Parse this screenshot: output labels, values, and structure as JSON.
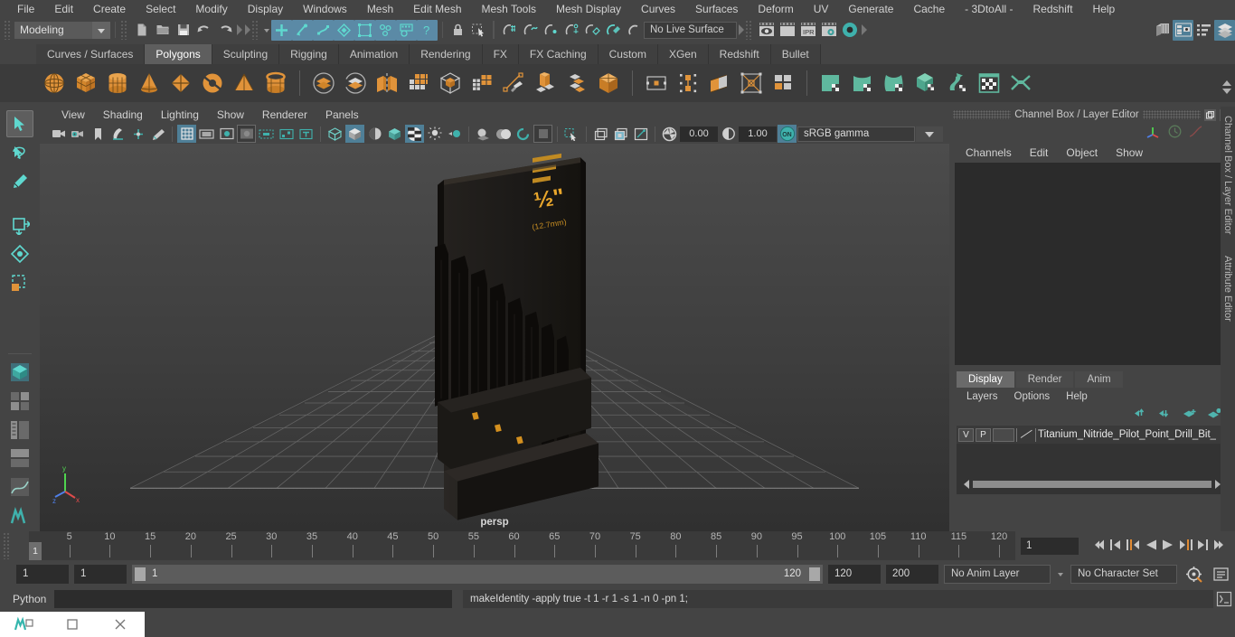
{
  "app": {
    "name": "Autodesk Maya"
  },
  "menubar": {
    "items": [
      "File",
      "Edit",
      "Create",
      "Select",
      "Modify",
      "Display",
      "Windows",
      "Mesh",
      "Edit Mesh",
      "Mesh Tools",
      "Mesh Display",
      "Curves",
      "Surfaces",
      "Deform",
      "UV",
      "Generate",
      "Cache",
      "- 3DtoAll -",
      "Redshift",
      "Help"
    ]
  },
  "statusline": {
    "menu_set": "Modeling",
    "live_surface": "No Live Surface",
    "icons": [
      "new-scene-icon",
      "open-scene-icon",
      "save-scene-icon",
      "undo-icon",
      "redo-icon",
      "select-by-hierarchy-icon",
      "select-by-object-icon",
      "select-by-component-icon",
      "snap-to-grid-icon",
      "snap-to-curve-icon",
      "snap-to-point-icon",
      "snap-to-projected-center-icon",
      "snap-to-view-plane-icon",
      "make-live-icon",
      "render-current-frame-icon",
      "ipr-render-icon",
      "render-settings-icon",
      "render-view-icon",
      "show-hide-editors-icon",
      "sidebar-channel-box-icon",
      "sidebar-attribute-editor-icon",
      "sidebar-tool-settings-icon"
    ]
  },
  "shelf": {
    "tabs": [
      "Curves / Surfaces",
      "Polygons",
      "Sculpting",
      "Rigging",
      "Animation",
      "Rendering",
      "FX",
      "FX Caching",
      "Custom",
      "XGen",
      "Redshift",
      "Bullet"
    ],
    "active_tab": "Polygons",
    "icons": [
      "poly-sphere-icon",
      "poly-cube-icon",
      "poly-cylinder-icon",
      "poly-cone-icon",
      "poly-plane-icon",
      "poly-torus-icon",
      "poly-pyramid-icon",
      "poly-pipe-icon",
      "poly-booleans-union-icon",
      "poly-booleans-difference-icon",
      "poly-mirror-icon",
      "poly-smooth-icon",
      "poly-combine-icon",
      "poly-reduce-icon",
      "poly-multi-cut-icon",
      "poly-extrude-icon",
      "poly-bevel-icon",
      "poly-bridge-icon",
      "poly-target-weld-icon",
      "poly-connect-icon",
      "poly-append-icon",
      "poly-crease-icon",
      "poly-quad-draw-icon",
      "uv-planar-icon",
      "uv-cylindrical-icon",
      "uv-spherical-icon",
      "uv-automatic-icon",
      "uv-unfold-icon",
      "uv-editor-icon",
      "uv-cut-sew-icon"
    ]
  },
  "toolbox": {
    "tools": [
      "select-tool",
      "lasso-select-tool",
      "paint-select-tool",
      "move-tool",
      "rotate-tool",
      "scale-tool",
      "last-tool-used",
      "show-manipulator-tool"
    ],
    "layout_icons": [
      "single-perspective-layout-icon",
      "four-view-layout-icon",
      "outliner-persp-layout-icon",
      "hypershade-layout-icon",
      "persp-graph-layout-icon",
      "maya-embedded-layout-icon"
    ]
  },
  "viewport": {
    "menus": [
      "View",
      "Shading",
      "Lighting",
      "Show",
      "Renderer",
      "Panels"
    ],
    "camera_label": "persp",
    "exposure": "0.00",
    "gamma": "1.00",
    "color_space": "sRGB gamma",
    "toolbar_icons": [
      "select-camera-icon",
      "camera-attributes-icon",
      "bookmarks-icon",
      "image-plane-icon",
      "two-d-pan-zoom-icon",
      "grease-pencil-icon",
      "grid-toggle-icon",
      "film-gate-icon",
      "resolution-gate-icon",
      "gate-mask-icon",
      "xray-joints-icon",
      "xray-active-components-icon",
      "text-toggle-icon",
      "wireframe-icon",
      "smooth-shade-all-icon",
      "shaded-wireframe-icon",
      "textured-icon",
      "use-default-light-icon",
      "use-all-lights-icon",
      "shadows-icon",
      "screen-space-ao-icon",
      "motion-blur-icon",
      "multisample-icon",
      "isolate-select-icon",
      "xray-icon",
      "xray-active-icon",
      "xray-joints-2-icon",
      "exposure-icon",
      "gamma-icon",
      "color-management-icon"
    ]
  },
  "channel_box": {
    "title": "Channel Box / Layer Editor",
    "menus": [
      "Channels",
      "Edit",
      "Object",
      "Show"
    ],
    "header_icons": [
      "axis-gizmo-icon",
      "clock-icon",
      "curve-icon"
    ],
    "window_buttons": [
      "undock-icon",
      "close-icon"
    ],
    "side_tabs": [
      "Channel Box / Layer Editor",
      "Attribute Editor"
    ]
  },
  "layer_editor": {
    "tabs": [
      "Display",
      "Render",
      "Anim"
    ],
    "active_tab": "Display",
    "menus": [
      "Layers",
      "Options",
      "Help"
    ],
    "toolbar_icons": [
      "move-layer-up-icon",
      "move-layer-down-icon",
      "new-layer-icon",
      "new-layer-from-selected-icon"
    ],
    "layers": [
      {
        "visibility": "V",
        "playback": "P",
        "type": "",
        "name": "Titanium_Nitride_Pilot_Point_Drill_Bit_"
      }
    ]
  },
  "timeline": {
    "ticks": [
      5,
      10,
      15,
      20,
      25,
      30,
      35,
      40,
      45,
      50,
      55,
      60,
      65,
      70,
      75,
      80,
      85,
      90,
      95,
      100,
      105,
      110,
      115,
      120
    ],
    "current_frame": "1",
    "frame_field": "1",
    "range_start": "1",
    "range_end": "1",
    "slider_start": "1",
    "slider_end": "120",
    "playback_end": "120",
    "anim_end": "200",
    "anim_layer": "No Anim Layer",
    "character_set": "No Character Set",
    "playback_buttons": [
      "go-to-start-icon",
      "step-back-frame-icon",
      "step-back-key-icon",
      "play-backwards-icon",
      "play-forwards-icon",
      "step-forward-key-icon",
      "step-forward-frame-icon",
      "go-to-end-icon"
    ],
    "auto_key_icon": "auto-keyframe-icon",
    "prefs_icon": "animation-preferences-icon"
  },
  "command_line": {
    "language": "Python",
    "input_value": "",
    "output": "makeIdentity -apply true -t 1 -r 1 -s 1 -n 0 -pn 1;",
    "script_editor_icon": "script-editor-icon"
  },
  "taskbar": {
    "items": [
      "maya-app-icon",
      "restore-window-icon",
      "minimize-window-icon",
      "close-window-icon"
    ]
  },
  "colors": {
    "background": "#444444",
    "panel": "#3b3b3b",
    "viewport_bg": "#3a3a3a",
    "accent_blue": "#5b8aa6",
    "accent_teal": "#4eb0a8",
    "shelf_orange": "#e0922f",
    "model_body": "#1d1a17",
    "model_label": "#d89b2a",
    "text": "#cfcfcf"
  },
  "model": {
    "label_size": "1/2\"",
    "label_sub": "(12.7mm)",
    "object_name": "Titanium_Nitride_Pilot_Point_Drill_Bit_"
  }
}
